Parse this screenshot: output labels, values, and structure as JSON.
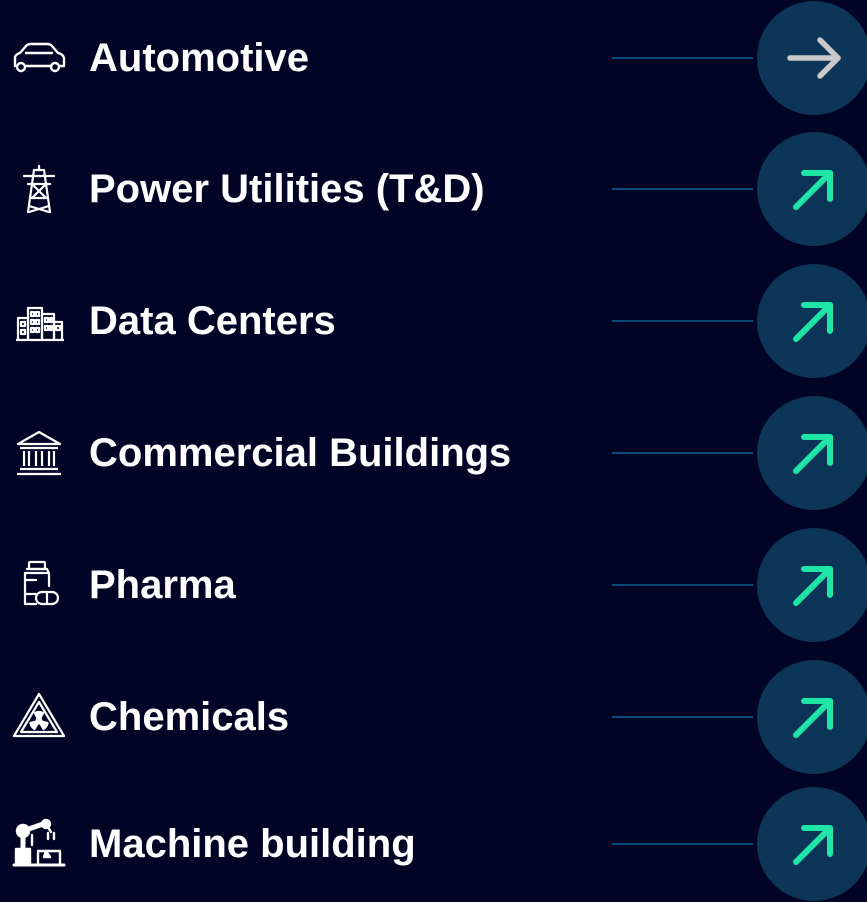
{
  "theme": {
    "background": "#020426",
    "label_color": "#ffffff",
    "connector_color": "#0a4a78",
    "circle_color": "#0c3558",
    "arrow_neutral_color": "#c9c9c9",
    "arrow_up_color": "#1fe6a6"
  },
  "rows": [
    {
      "label": "Automotive",
      "icon": "car-icon",
      "arrow": "right-arrow-icon",
      "trend": "neutral"
    },
    {
      "label": "Power Utilities (T&D)",
      "icon": "power-tower-icon",
      "arrow": "up-right-arrow-icon",
      "trend": "up"
    },
    {
      "label": "Data Centers",
      "icon": "buildings-icon",
      "arrow": "up-right-arrow-icon",
      "trend": "up"
    },
    {
      "label": "Commercial Buildings",
      "icon": "bank-icon",
      "arrow": "up-right-arrow-icon",
      "trend": "up"
    },
    {
      "label": "Pharma",
      "icon": "pill-bottle-icon",
      "arrow": "up-right-arrow-icon",
      "trend": "up"
    },
    {
      "label": "Chemicals",
      "icon": "hazard-triangle-icon",
      "arrow": "up-right-arrow-icon",
      "trend": "up"
    },
    {
      "label": "Machine building",
      "icon": "robot-arm-icon",
      "arrow": "up-right-arrow-icon",
      "trend": "up"
    }
  ]
}
